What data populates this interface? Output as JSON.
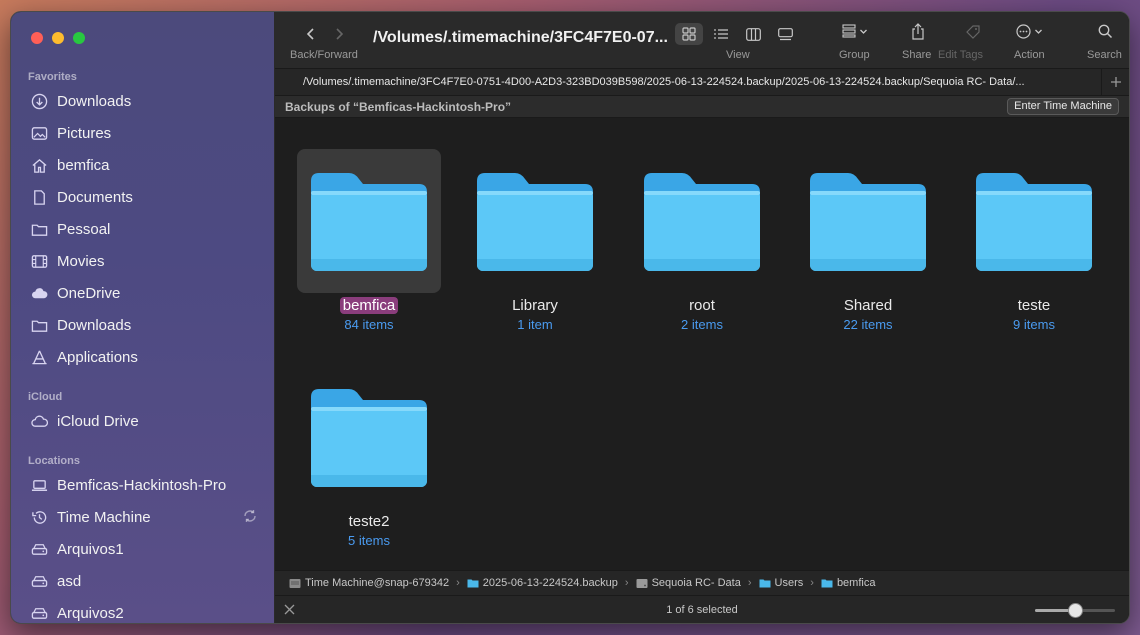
{
  "window": {
    "title": "/Volumes/.timemachine/3FC4F7E0-07..."
  },
  "toolbar": {
    "back_forward_label": "Back/Forward",
    "view_label": "View",
    "group_label": "Group",
    "share_label": "Share",
    "edit_tags_label": "Edit Tags",
    "action_label": "Action",
    "search_label": "Search"
  },
  "path_tab": "/Volumes/.timemachine/3FC4F7E0-0751-4D00-A2D3-323BD039B598/2025-06-13-224524.backup/2025-06-13-224524.backup/Sequoia RC- Data/...",
  "tm_bar": {
    "text": "Backups of “Bemficas-Hackintosh-Pro”",
    "button": "Enter Time Machine"
  },
  "sidebar": {
    "favorites_heading": "Favorites",
    "favorites": [
      {
        "label": "Downloads",
        "icon": "download-icon"
      },
      {
        "label": "Pictures",
        "icon": "photo-icon"
      },
      {
        "label": "bemfica",
        "icon": "home-icon"
      },
      {
        "label": "Documents",
        "icon": "document-icon"
      },
      {
        "label": "Pessoal",
        "icon": "folder-icon"
      },
      {
        "label": "Movies",
        "icon": "film-icon"
      },
      {
        "label": "OneDrive",
        "icon": "cloud-icon"
      },
      {
        "label": "Downloads",
        "icon": "folder-icon"
      },
      {
        "label": "Applications",
        "icon": "applications-icon"
      }
    ],
    "icloud_heading": "iCloud",
    "icloud": [
      {
        "label": "iCloud Drive",
        "icon": "cloud-outline-icon"
      }
    ],
    "locations_heading": "Locations",
    "locations": [
      {
        "label": "Bemficas-Hackintosh-Pro",
        "icon": "laptop-icon"
      },
      {
        "label": "Time Machine",
        "icon": "time-machine-icon"
      },
      {
        "label": "Arquivos1",
        "icon": "drive-icon"
      },
      {
        "label": "asd",
        "icon": "drive-icon"
      },
      {
        "label": "Arquivos2",
        "icon": "drive-icon"
      }
    ]
  },
  "items": [
    {
      "name": "bemfica",
      "count": "84 items",
      "selected": true
    },
    {
      "name": "Library",
      "count": "1 item"
    },
    {
      "name": "root",
      "count": "2 items"
    },
    {
      "name": "Shared",
      "count": "22 items"
    },
    {
      "name": "teste",
      "count": "9 items"
    },
    {
      "name": "teste2",
      "count": "5 items"
    }
  ],
  "path_bar": [
    "Time Machine@snap-679342",
    "2025-06-13-224524.backup",
    "Sequoia RC- Data",
    "Users",
    "bemfica"
  ],
  "status": {
    "text": "1 of 6 selected",
    "zoom_fraction": 0.5
  },
  "colors": {
    "folder": "#5bc4f5",
    "selection": "#8a3d7c",
    "accent": "#4a9bf0"
  }
}
